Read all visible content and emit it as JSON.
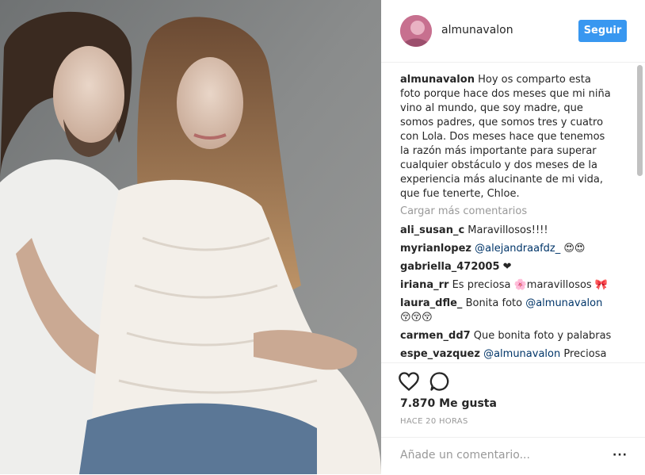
{
  "post": {
    "username": "almunavalon",
    "follow_label": "Seguir",
    "caption_user": "almunavalon",
    "caption_text": " Hoy os comparto esta foto porque hace dos meses que mi niña vino al mundo, que soy madre, que somos padres, que somos tres y cuatro con Lola. Dos meses hace que tenemos la razón más importante para superar cualquier obstáculo y dos meses de la experiencia más alucinante de mi vida, que fue tenerte, Chloe.",
    "load_more": "Cargar más comentarios",
    "comments": [
      {
        "user": "ali_susan_c",
        "text": " Maravillosos!!!!"
      },
      {
        "user": "myrianlopez",
        "mention": "@alejandraafdz_",
        "text": " 😍😍"
      },
      {
        "user": "gabriella_472005",
        "text": " ❤"
      },
      {
        "user": "iriana_rr",
        "text": " Es preciosa 🌸maravillosos 🎀"
      },
      {
        "user": "laura_dfle_",
        "text": " Bonita foto ",
        "mention": "@almunavalon",
        "text2": "😚😚😚"
      },
      {
        "user": "carmen_dd7",
        "text": " Que bonita foto y palabras"
      },
      {
        "user": "espe_vazquez",
        "mention": "@almunavalon",
        "text": " Preciosa"
      }
    ],
    "likes": "7.870 Me gusta",
    "time": "HACE 20 HORAS",
    "add_comment_placeholder": "Añade un comentario...",
    "more_label": "···"
  },
  "colors": {
    "accent": "#3897f0",
    "mention": "#003569",
    "muted": "#999999"
  },
  "icons": [
    "heart-icon",
    "comment-icon",
    "more-options-icon"
  ]
}
